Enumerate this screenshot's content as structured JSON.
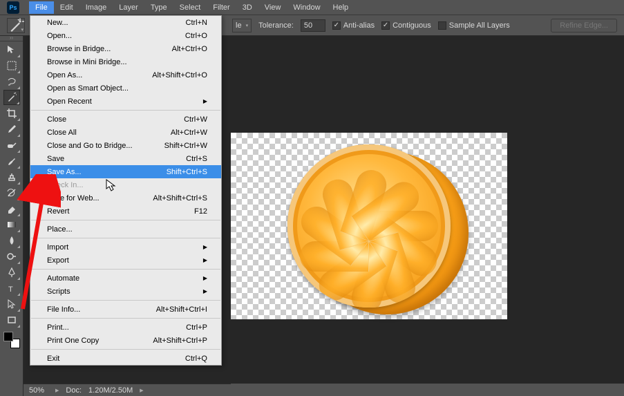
{
  "menubar": {
    "items": [
      "File",
      "Edit",
      "Image",
      "Layer",
      "Type",
      "Select",
      "Filter",
      "3D",
      "View",
      "Window",
      "Help"
    ],
    "open_index": 0
  },
  "optionsbar": {
    "sample_suffix": "le",
    "tolerance_label": "Tolerance:",
    "tolerance_value": "50",
    "anti_alias": {
      "label": "Anti-alias",
      "checked": true
    },
    "contiguous": {
      "label": "Contiguous",
      "checked": true
    },
    "sample_all": {
      "label": "Sample All Layers",
      "checked": false
    },
    "refine_btn": "Refine Edge..."
  },
  "file_menu": [
    {
      "label": "New...",
      "shortcut": "Ctrl+N"
    },
    {
      "label": "Open...",
      "shortcut": "Ctrl+O"
    },
    {
      "label": "Browse in Bridge...",
      "shortcut": "Alt+Ctrl+O"
    },
    {
      "label": "Browse in Mini Bridge..."
    },
    {
      "label": "Open As...",
      "shortcut": "Alt+Shift+Ctrl+O"
    },
    {
      "label": "Open as Smart Object..."
    },
    {
      "label": "Open Recent",
      "submenu": true
    },
    {
      "separator": true
    },
    {
      "label": "Close",
      "shortcut": "Ctrl+W"
    },
    {
      "label": "Close All",
      "shortcut": "Alt+Ctrl+W"
    },
    {
      "label": "Close and Go to Bridge...",
      "shortcut": "Shift+Ctrl+W"
    },
    {
      "label": "Save",
      "shortcut": "Ctrl+S"
    },
    {
      "label": "Save As...",
      "shortcut": "Shift+Ctrl+S",
      "selected": true
    },
    {
      "label": "Check In...",
      "disabled": true
    },
    {
      "label": "Save for Web...",
      "shortcut": "Alt+Shift+Ctrl+S"
    },
    {
      "label": "Revert",
      "shortcut": "F12"
    },
    {
      "separator": true
    },
    {
      "label": "Place..."
    },
    {
      "separator": true
    },
    {
      "label": "Import",
      "submenu": true
    },
    {
      "label": "Export",
      "submenu": true
    },
    {
      "separator": true
    },
    {
      "label": "Automate",
      "submenu": true
    },
    {
      "label": "Scripts",
      "submenu": true
    },
    {
      "separator": true
    },
    {
      "label": "File Info...",
      "shortcut": "Alt+Shift+Ctrl+I"
    },
    {
      "separator": true
    },
    {
      "label": "Print...",
      "shortcut": "Ctrl+P"
    },
    {
      "label": "Print One Copy",
      "shortcut": "Alt+Shift+Ctrl+P"
    },
    {
      "separator": true
    },
    {
      "label": "Exit",
      "shortcut": "Ctrl+Q"
    }
  ],
  "statusbar": {
    "zoom": "50%",
    "doc_label": "Doc:",
    "doc_value": "1.20M/2.50M"
  }
}
